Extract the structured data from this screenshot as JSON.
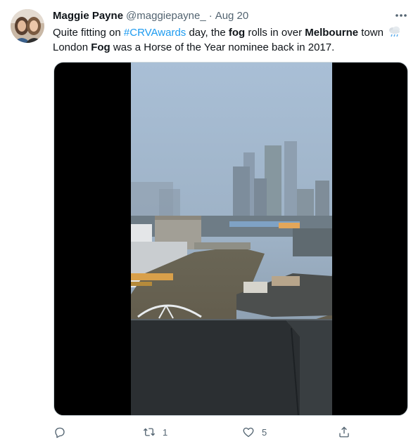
{
  "author": {
    "display_name": "Maggie Payne",
    "handle": "@maggiepayne_",
    "separator": "·",
    "time": "Aug 20"
  },
  "tweet": {
    "line1_pre": "Quite fitting on ",
    "hashtag": "#CRVAwards",
    "line1_mid": " day, the ",
    "bold_fog_1": "fog",
    "line1_post": " rolls in over ",
    "bold_melbourne": "Melbourne",
    "line1_end": " town ",
    "line2_pre": "London ",
    "bold_fog_2": "Fog",
    "line2_post": " was a Horse of the Year nominee back in 2017."
  },
  "icons": {
    "more": "more-icon",
    "emoji": "cloud-with-rain-icon",
    "reply": "reply-icon",
    "retweet": "retweet-icon",
    "like": "heart-icon",
    "share": "share-icon"
  },
  "actions": {
    "reply_count": "",
    "retweet_count": "1",
    "like_count": "5"
  },
  "colors": {
    "accent": "#1d9bf0",
    "secondary_text": "#536471",
    "text": "#0f1419"
  }
}
